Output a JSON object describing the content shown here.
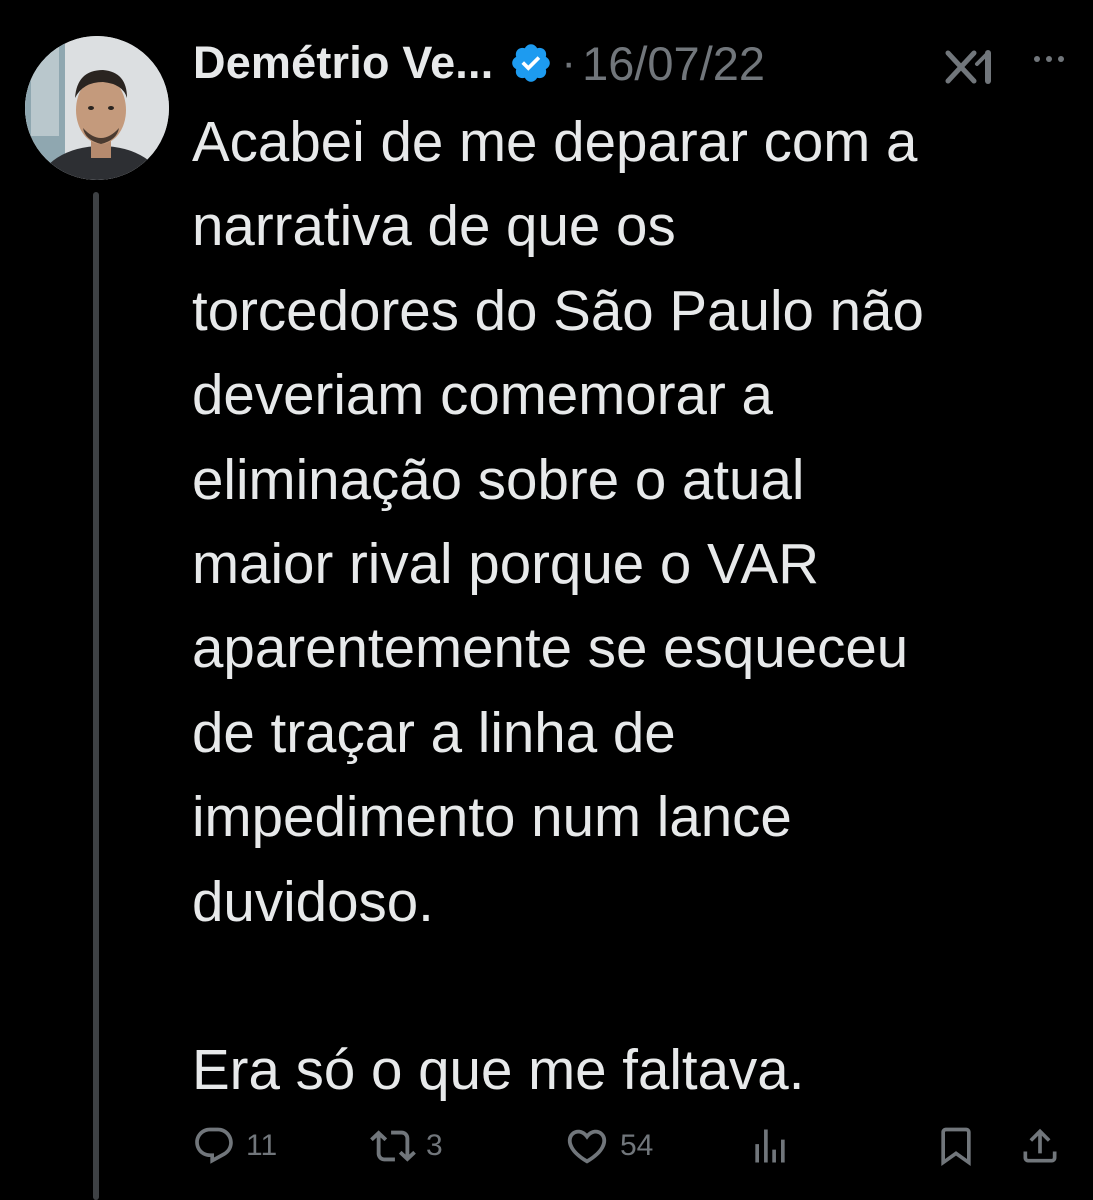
{
  "author": {
    "name": "Demétrio Ve...",
    "verified": true
  },
  "tweet": {
    "separator": "·",
    "date": "16/07/22",
    "lines": [
      "Acabei de me deparar com a",
      "narrativa de que os",
      "torcedores do São Paulo não",
      "deveriam comemorar a",
      "eliminação sobre o atual",
      "maior rival porque o VAR",
      "aparentemente se esqueceu",
      "de traçar a linha de",
      "impedimento num lance",
      "duvidoso.",
      "",
      "Era só o que me faltava."
    ]
  },
  "actions": {
    "replies": "11",
    "retweets": "3",
    "likes": "54"
  },
  "colors": {
    "background": "#000000",
    "text": "#e7e9ea",
    "muted": "#71767b",
    "verified_badge": "#1d9bf0",
    "thread_line": "#3e4144"
  },
  "icons": [
    "verified-badge-icon",
    "grok-icon",
    "more-options-icon",
    "reply-icon",
    "retweet-icon",
    "like-icon",
    "views-icon",
    "bookmark-icon",
    "share-icon"
  ]
}
